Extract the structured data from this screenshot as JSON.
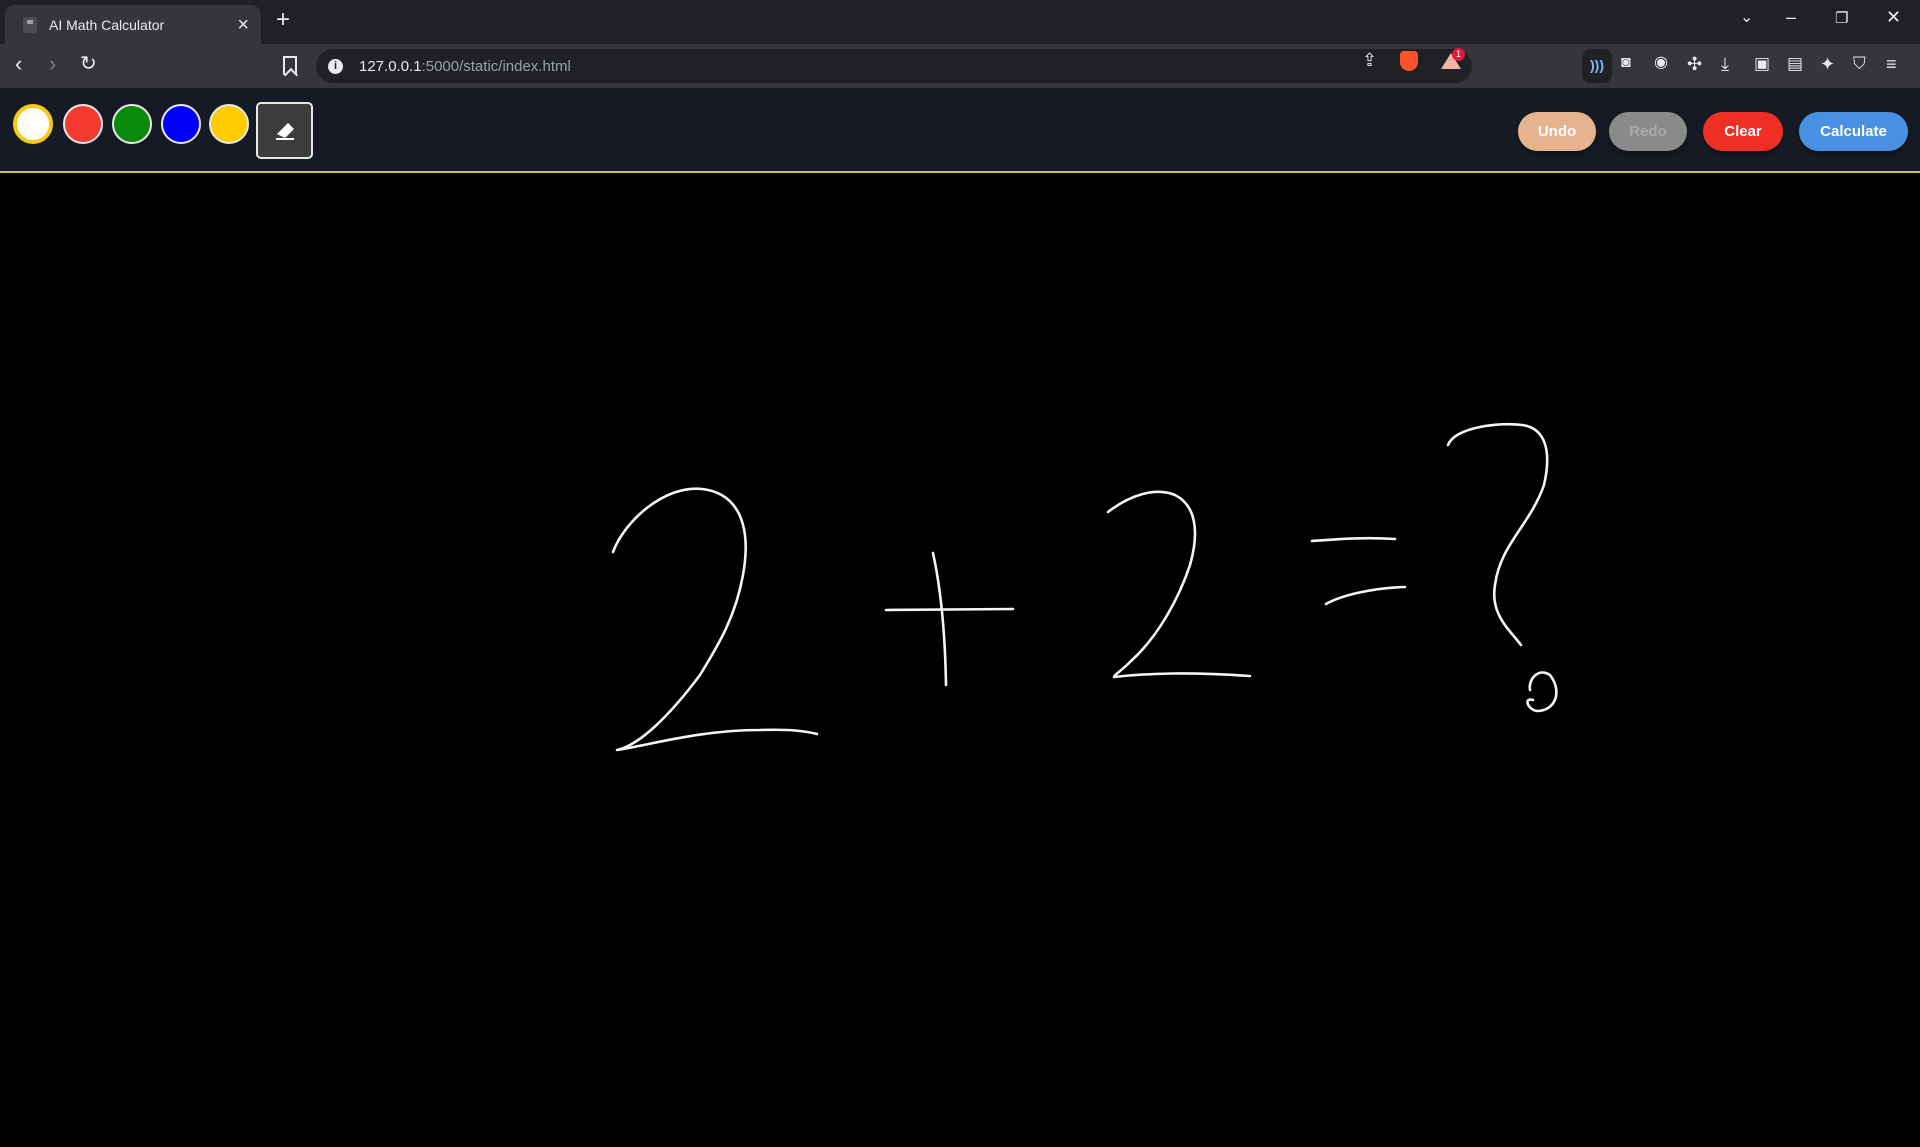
{
  "browser": {
    "tab_title": "AI Math Calculator",
    "url_host": "127.0.0.1",
    "url_rest": ":5000/static/index.html",
    "rewards_badge": "1",
    "icons": {
      "tab_close": "close-icon",
      "new_tab": "plus-icon",
      "tab_list": "chevron-down-icon",
      "minimize": "minimize-icon",
      "restore": "restore-icon",
      "close_window": "close-icon",
      "back": "back-arrow-icon",
      "forward": "forward-arrow-icon",
      "reload": "reload-icon",
      "bookmark": "bookmark-icon",
      "site_info": "info-icon",
      "share": "share-icon",
      "brave_shields": "brave-lion-icon",
      "rewards": "rewards-triangle-icon",
      "extension_wifi": "broadcast-icon",
      "camera": "camera-icon",
      "mask": "mask-icon",
      "extensions": "puzzle-icon",
      "download": "download-icon",
      "sidebar": "sidebar-icon",
      "wallet": "wallet-icon",
      "leo": "sparkle-icon",
      "vpn": "shield-icon",
      "menu": "hamburger-menu-icon"
    }
  },
  "app": {
    "colors": [
      {
        "name": "white",
        "hex": "#ffffff",
        "selected": true
      },
      {
        "name": "red",
        "hex": "#f43a2f",
        "selected": false
      },
      {
        "name": "green",
        "hex": "#0a8a0a",
        "selected": false
      },
      {
        "name": "blue",
        "hex": "#0000ff",
        "selected": false
      },
      {
        "name": "yellow",
        "hex": "#ffcc00",
        "selected": false
      }
    ],
    "eraser_icon": "eraser-icon",
    "buttons": {
      "undo": {
        "label": "Undo",
        "color": "#e5b48f",
        "enabled": true
      },
      "redo": {
        "label": "Redo",
        "color": "#8a8a8a",
        "enabled": false
      },
      "clear": {
        "label": "Clear",
        "color": "#f02f24",
        "enabled": true
      },
      "calculate": {
        "label": "Calculate",
        "color": "#4a90e2",
        "enabled": true
      }
    },
    "accent_border": "#e2c23a"
  },
  "canvas": {
    "background": "#000000",
    "stroke_color": "#f4f4f4",
    "drawn_expression": "2 + 2 = ?"
  }
}
